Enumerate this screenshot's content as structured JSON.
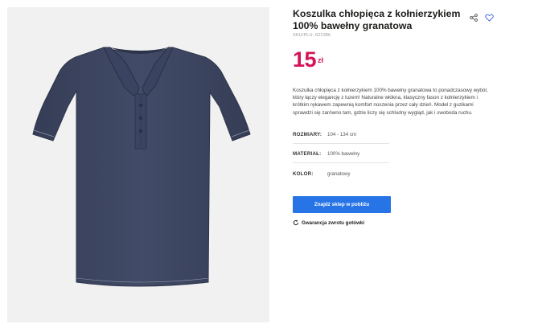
{
  "product": {
    "title": "Koszulka chłopięca z kołnierzykiem 100% bawełny granatowa",
    "sku": "SKU/PLU: 622386",
    "price_value": "15",
    "price_currency": "zł",
    "description": "Koszulka chłopięca z kołnierzykiem 100% bawełny granatowa to ponadczasowy wybór, który łączy elegancję z luzem! Naturalne włókna, klasyczny fason z kołnierzykiem i krótkim rękawem zapewnią komfort noszenia przez cały dzień. Model z guzikami sprawdzi się zarówno tam, gdzie liczy się schludny wygląd, jak i swoboda ruchu.",
    "attributes": [
      {
        "label": "ROZMIARY:",
        "value": "104 - 134 cm"
      },
      {
        "label": "MATERIAŁ:",
        "value": "100% bawełny"
      },
      {
        "label": "KOLOR:",
        "value": "granatowy"
      }
    ],
    "cta_label": "Znajdź sklep w pobliżu",
    "guarantee_label": "Gwarancja zwrotu gotówki"
  },
  "icons": {
    "share": "share-icon",
    "favorite": "heart-icon",
    "guarantee": "refresh-icon"
  },
  "colors": {
    "price": "#d4145a",
    "cta_bg": "#2774e6",
    "shirt": "#3c4560",
    "image_bg": "#f1f1f1"
  }
}
